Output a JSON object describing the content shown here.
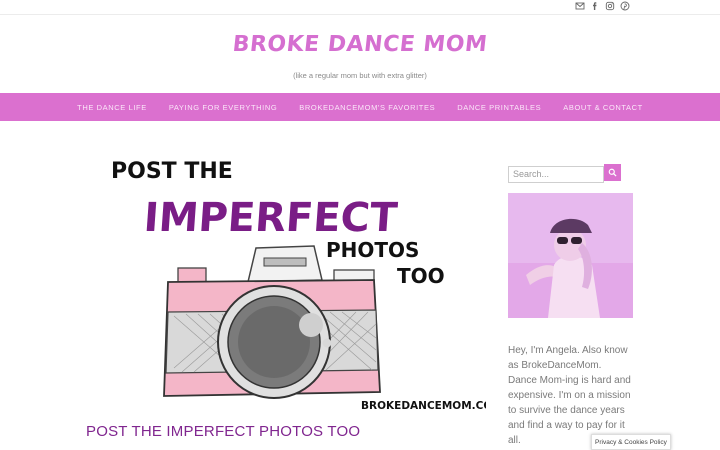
{
  "topbar": {
    "icons": [
      "mail-icon",
      "facebook-icon",
      "instagram-icon",
      "pinterest-icon"
    ]
  },
  "header": {
    "title": "Broke Dance Mom",
    "tagline": "(like a regular mom but with extra glitter)"
  },
  "nav": {
    "items": [
      "THE DANCE LIFE",
      "PAYING FOR EVERYTHING",
      "BROKEDANCEMOM'S FAVORITES",
      "DANCE PRINTABLES",
      "ABOUT & CONTACT"
    ]
  },
  "feature": {
    "line1": "POST THE",
    "line2": "IMPERFECT",
    "line3": "PHOTOS",
    "line4": "TOO",
    "watermark": "BROKEDANCEMOM.COM"
  },
  "post": {
    "title": "POST THE IMPERFECT PHOTOS TOO"
  },
  "sidebar": {
    "search_placeholder": "Search...",
    "bio": "Hey, I'm Angela. Also know as BrokeDanceMom. Dance Mom-ing is hard and expensive. I'm on a mission to survive the dance years and find a way to pay for it all."
  },
  "privacy": {
    "label": "Privacy & Cookies Policy"
  },
  "colors": {
    "accent": "#db70cf",
    "title": "#d56fd0",
    "post_title": "#80268f",
    "imperfect": "#7a1d86",
    "camera_pink": "#f4b6c8"
  }
}
